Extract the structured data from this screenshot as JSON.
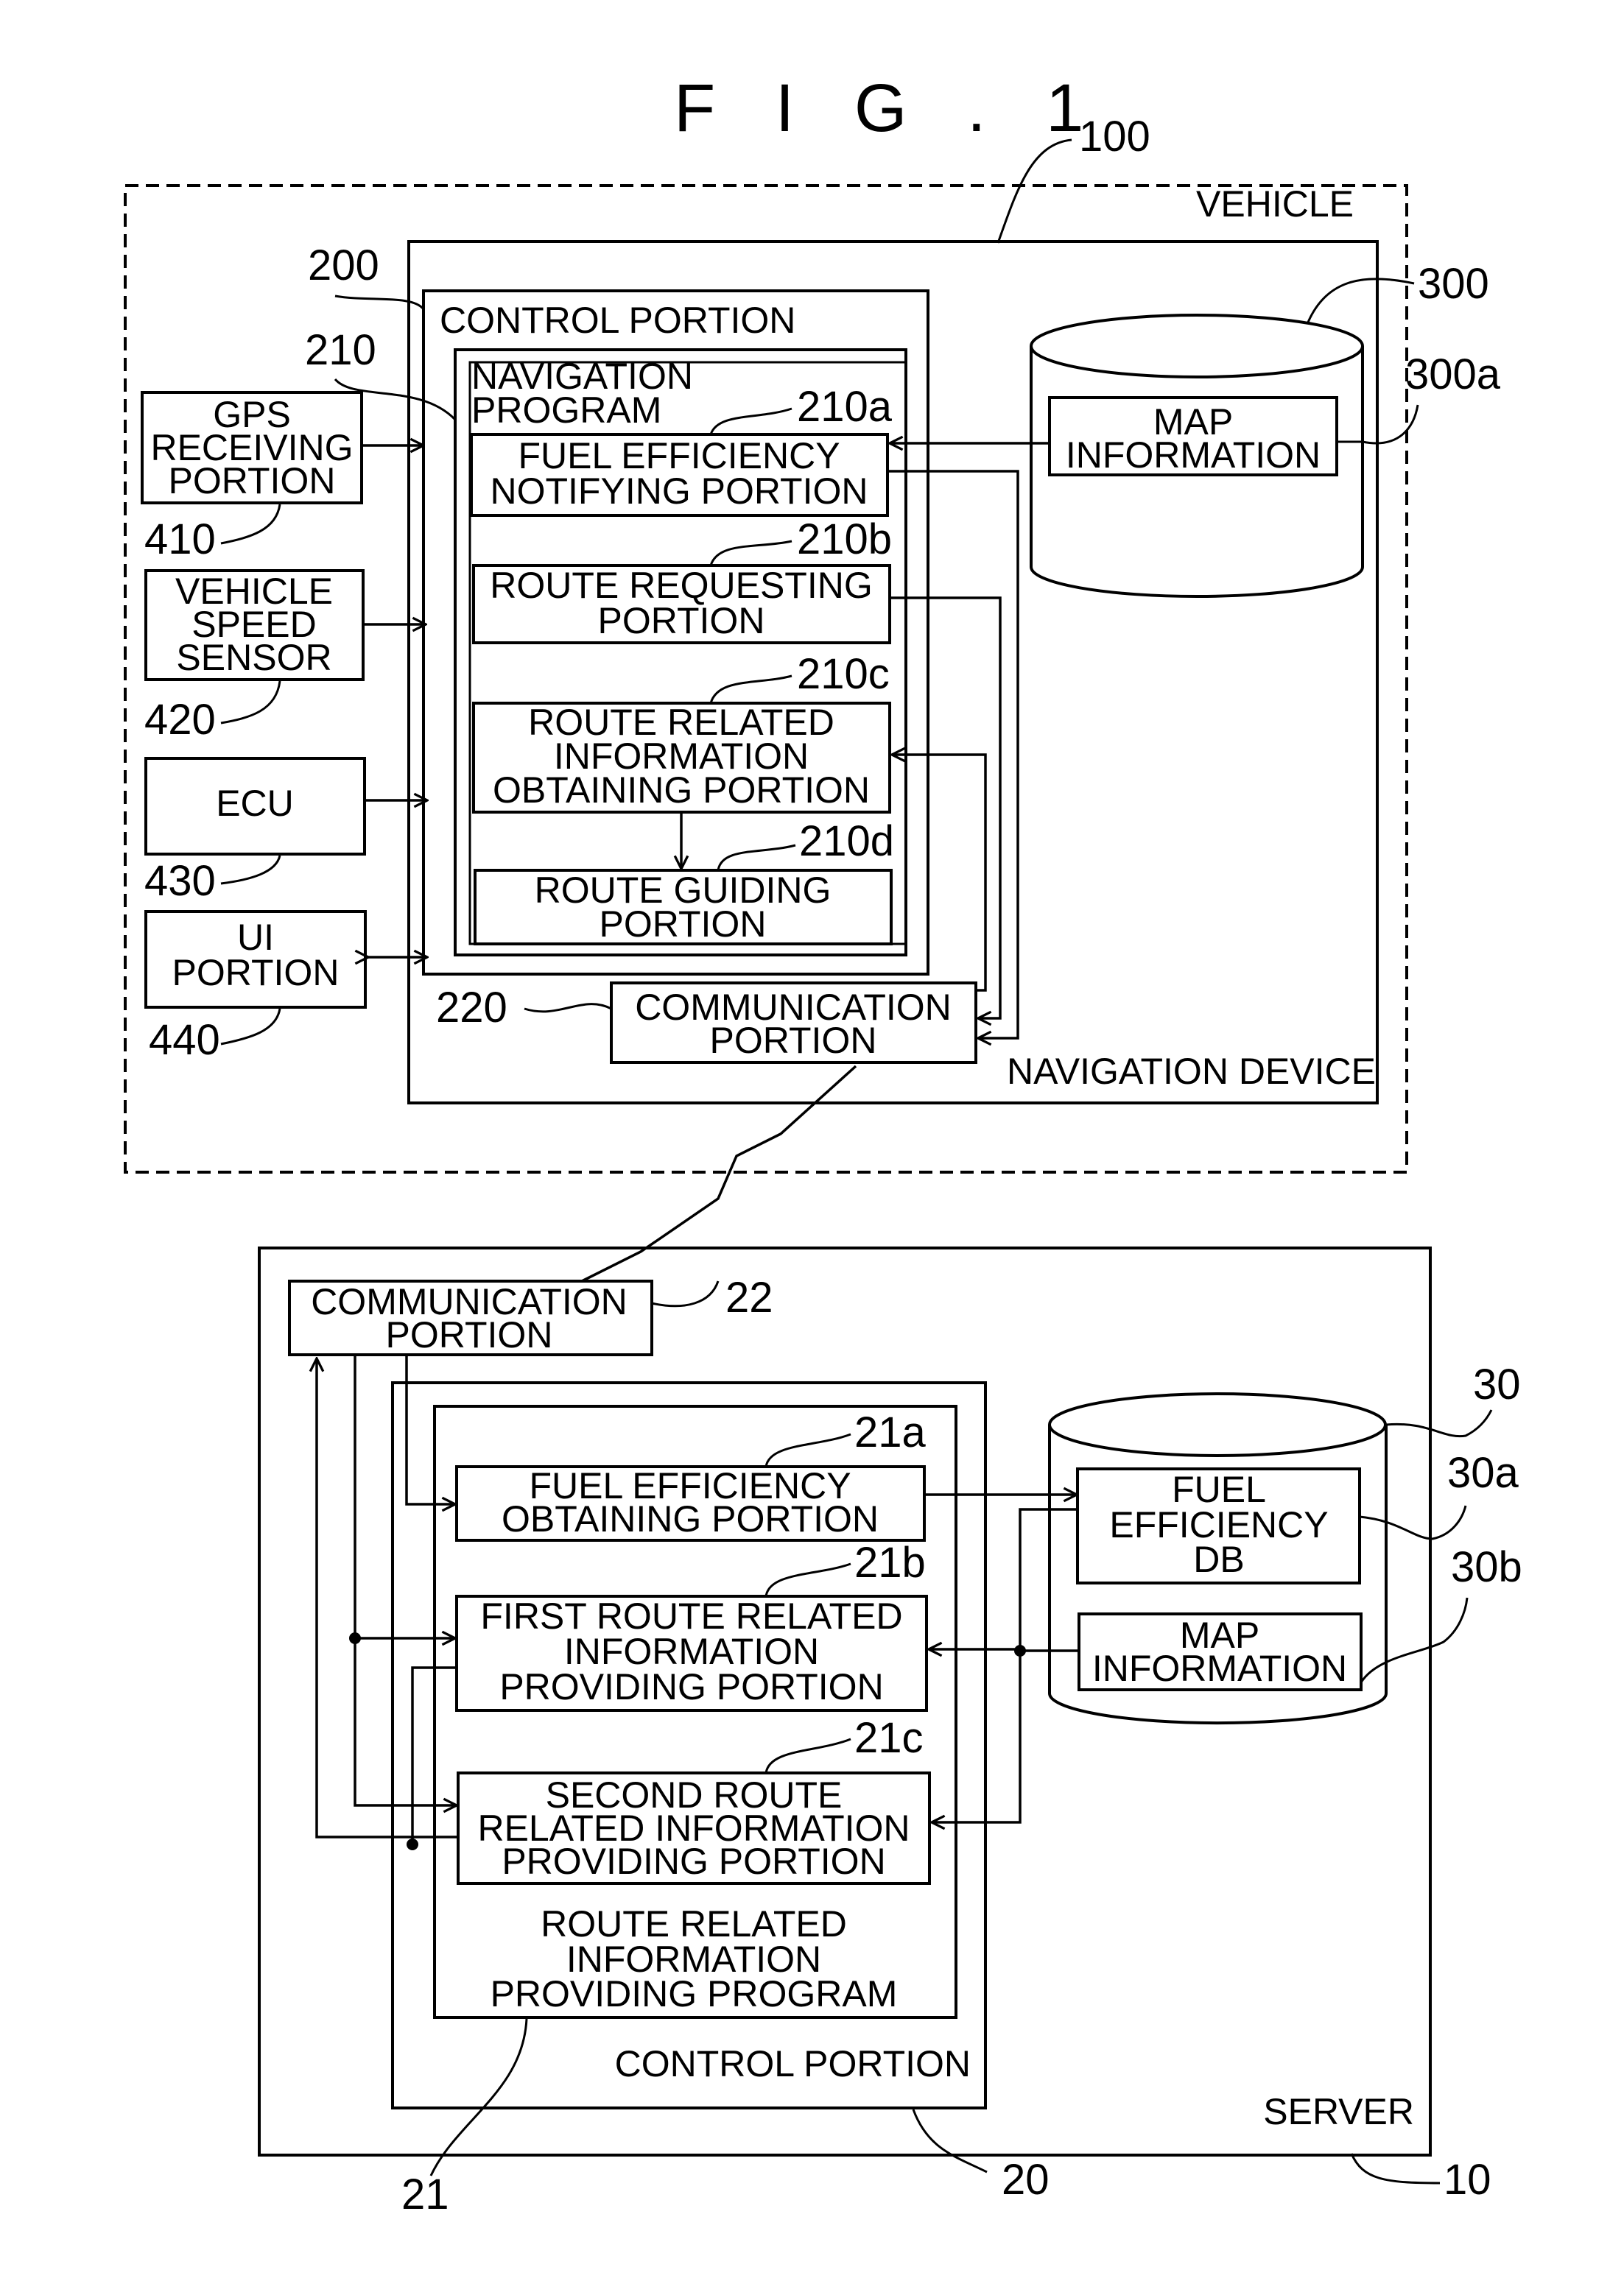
{
  "figure_title": "F I G . 1",
  "vehicle": {
    "label": "VEHICLE",
    "ref": "100",
    "navigation_device": {
      "label": "NAVIGATION DEVICE",
      "control_portion": {
        "label": "CONTROL PORTION",
        "ref": "200",
        "navigation_program": {
          "label_line1": "NAVIGATION",
          "label_line2": "PROGRAM",
          "ref": "210",
          "modules": [
            {
              "ref": "210a",
              "lines": [
                "FUEL EFFICIENCY",
                "NOTIFYING PORTION"
              ]
            },
            {
              "ref": "210b",
              "lines": [
                "ROUTE REQUESTING",
                "PORTION"
              ]
            },
            {
              "ref": "210c",
              "lines": [
                "ROUTE RELATED",
                "INFORMATION",
                "OBTAINING PORTION"
              ]
            },
            {
              "ref": "210d",
              "lines": [
                "ROUTE GUIDING",
                "PORTION"
              ]
            }
          ]
        }
      },
      "communication_portion": {
        "ref": "220",
        "lines": [
          "COMMUNICATION",
          "PORTION"
        ]
      },
      "storage": {
        "ref": "300",
        "map_info": {
          "ref": "300a",
          "lines": [
            "MAP",
            "INFORMATION"
          ]
        }
      }
    },
    "peripherals": [
      {
        "ref": "410",
        "lines": [
          "GPS",
          "RECEIVING",
          "PORTION"
        ]
      },
      {
        "ref": "420",
        "lines": [
          "VEHICLE",
          "SPEED",
          "SENSOR"
        ]
      },
      {
        "ref": "430",
        "lines": [
          "ECU"
        ]
      },
      {
        "ref": "440",
        "lines": [
          "UI",
          "PORTION"
        ]
      }
    ]
  },
  "server": {
    "label": "SERVER",
    "ref": "10",
    "communication_portion": {
      "ref": "22",
      "lines": [
        "COMMUNICATION",
        "PORTION"
      ]
    },
    "control_portion": {
      "label": "CONTROL PORTION",
      "ref": "20",
      "program": {
        "ref": "21",
        "lines": [
          "ROUTE RELATED",
          "INFORMATION",
          "PROVIDING PROGRAM"
        ],
        "modules": [
          {
            "ref": "21a",
            "lines": [
              "FUEL EFFICIENCY",
              "OBTAINING PORTION"
            ]
          },
          {
            "ref": "21b",
            "lines": [
              "FIRST ROUTE RELATED",
              "INFORMATION",
              "PROVIDING PORTION"
            ]
          },
          {
            "ref": "21c",
            "lines": [
              "SECOND ROUTE",
              "RELATED INFORMATION",
              "PROVIDING PORTION"
            ]
          }
        ]
      }
    },
    "storage": {
      "ref": "30",
      "fuel_db": {
        "ref": "30a",
        "lines": [
          "FUEL",
          "EFFICIENCY",
          "DB"
        ]
      },
      "map_info": {
        "ref": "30b",
        "lines": [
          "MAP",
          "INFORMATION"
        ]
      }
    }
  }
}
